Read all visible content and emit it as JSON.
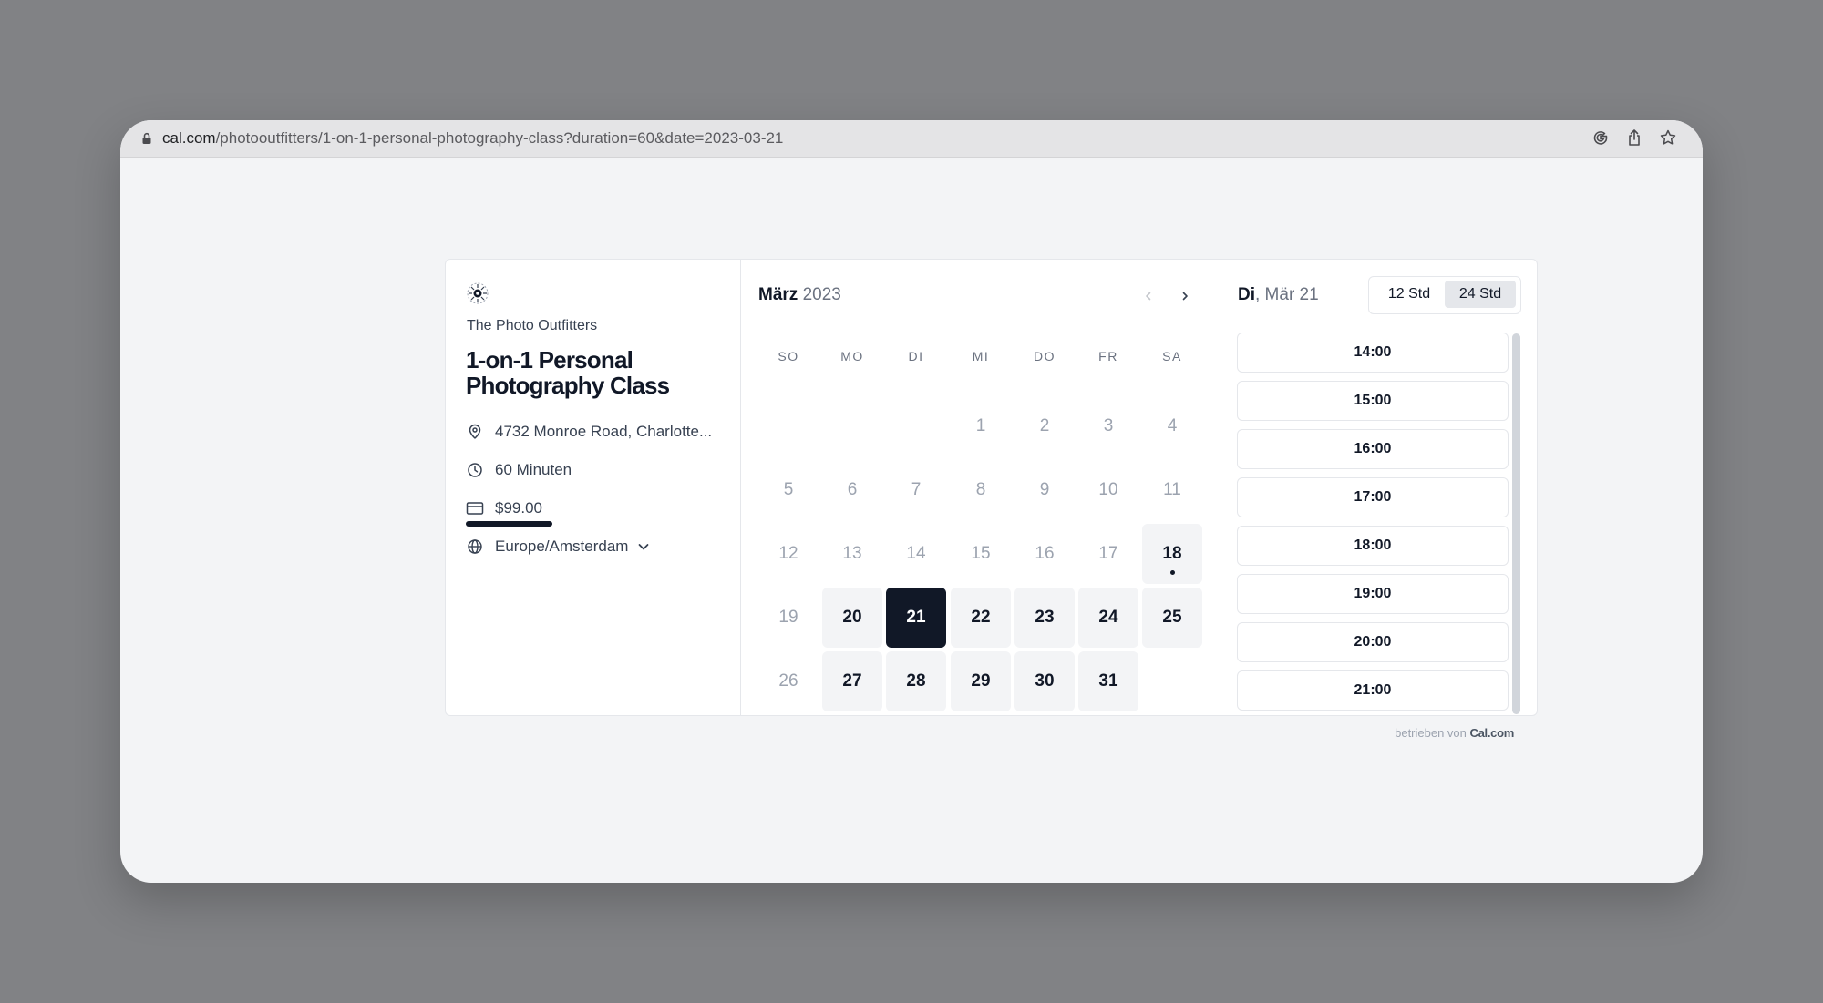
{
  "browser": {
    "url_host": "cal.com",
    "url_path": "/photooutfitters/1-on-1-personal-photography-class?duration=60&date=2023-03-21",
    "icons": [
      "google-icon",
      "share-icon",
      "star-icon"
    ]
  },
  "event": {
    "org_name": "The Photo Outfitters",
    "title": "1-on-1 Personal Photography Class",
    "location": "4732 Monroe Road, Charlotte...",
    "duration": "60 Minuten",
    "price": "$99.00",
    "timezone": "Europe/Amsterdam"
  },
  "calendar": {
    "month": "März",
    "year": "2023",
    "weekdays": [
      "SO",
      "MO",
      "DI",
      "MI",
      "DO",
      "FR",
      "SA"
    ],
    "weeks": [
      [
        null,
        null,
        null,
        {
          "d": "1"
        },
        {
          "d": "2"
        },
        {
          "d": "3"
        },
        {
          "d": "4"
        }
      ],
      [
        {
          "d": "5"
        },
        {
          "d": "6"
        },
        {
          "d": "7"
        },
        {
          "d": "8"
        },
        {
          "d": "9"
        },
        {
          "d": "10"
        },
        {
          "d": "11"
        }
      ],
      [
        {
          "d": "12"
        },
        {
          "d": "13"
        },
        {
          "d": "14"
        },
        {
          "d": "15"
        },
        {
          "d": "16"
        },
        {
          "d": "17"
        },
        {
          "d": "18",
          "state": "avail",
          "today": true
        }
      ],
      [
        {
          "d": "19"
        },
        {
          "d": "20",
          "state": "avail"
        },
        {
          "d": "21",
          "state": "sel"
        },
        {
          "d": "22",
          "state": "avail"
        },
        {
          "d": "23",
          "state": "avail"
        },
        {
          "d": "24",
          "state": "avail"
        },
        {
          "d": "25",
          "state": "avail"
        }
      ],
      [
        {
          "d": "26"
        },
        {
          "d": "27",
          "state": "avail"
        },
        {
          "d": "28",
          "state": "avail"
        },
        {
          "d": "29",
          "state": "avail"
        },
        {
          "d": "30",
          "state": "avail"
        },
        {
          "d": "31",
          "state": "avail"
        },
        null
      ]
    ]
  },
  "slots": {
    "day_name": "Di",
    "date_rest": ", Mär 21",
    "format_12": "12 Std",
    "format_24": "24 Std",
    "active_format": "24",
    "times": [
      "14:00",
      "15:00",
      "16:00",
      "17:00",
      "18:00",
      "19:00",
      "20:00",
      "21:00"
    ]
  },
  "footer": {
    "powered_prefix": "betrieben von",
    "brand": "Cal.com"
  },
  "colors": {
    "background": "#818285",
    "selected_day": "#111827",
    "available_day": "#f3f4f6"
  }
}
